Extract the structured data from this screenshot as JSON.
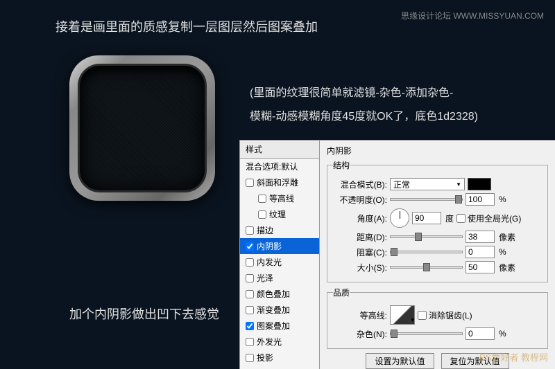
{
  "header": "接着是画里面的质感复制一层图层然后图案叠加",
  "watermark": "思缘设计论坛  WWW.MISSYUAN.COM",
  "explanation_line1": "(里面的纹理很简单就滤镜-杂色-添加杂色-",
  "explanation_line2": "模糊-动感模糊角度45度就OK了，底色1d2328)",
  "bottom_text": "加个内阴影做出凹下去感觉",
  "styles_column": {
    "header": "样式",
    "blend_options": "混合选项:默认",
    "bevel": "斜面和浮雕",
    "contour": "等高线",
    "texture": "纹理",
    "stroke": "描边",
    "inner_shadow": "内阴影",
    "inner_glow": "内发光",
    "satin": "光泽",
    "color_overlay": "颜色叠加",
    "gradient_overlay": "渐变叠加",
    "pattern_overlay": "图案叠加",
    "outer_glow": "外发光",
    "drop_shadow": "投影"
  },
  "panel": {
    "title": "内阴影",
    "structure_legend": "结构",
    "blend_mode_label": "混合模式(B):",
    "blend_mode_value": "正常",
    "opacity_label": "不透明度(O):",
    "opacity_value": "100",
    "opacity_unit": "%",
    "angle_label": "角度(A):",
    "angle_value": "90",
    "angle_unit": "度",
    "use_global_light": "使用全局光(G)",
    "distance_label": "距离(D):",
    "distance_value": "38",
    "distance_unit": "像素",
    "choke_label": "阻塞(C):",
    "choke_value": "0",
    "choke_unit": "%",
    "size_label": "大小(S):",
    "size_value": "50",
    "size_unit": "像素",
    "quality_legend": "品质",
    "contour_label": "等高线:",
    "anti_alias": "消除锯齿(L)",
    "noise_label": "杂色(N):",
    "noise_value": "0",
    "noise_unit": "%",
    "set_default": "设置为默认值",
    "reset_default": "复位为默认值"
  },
  "corner_watermark": "PS爱好者 教程网"
}
